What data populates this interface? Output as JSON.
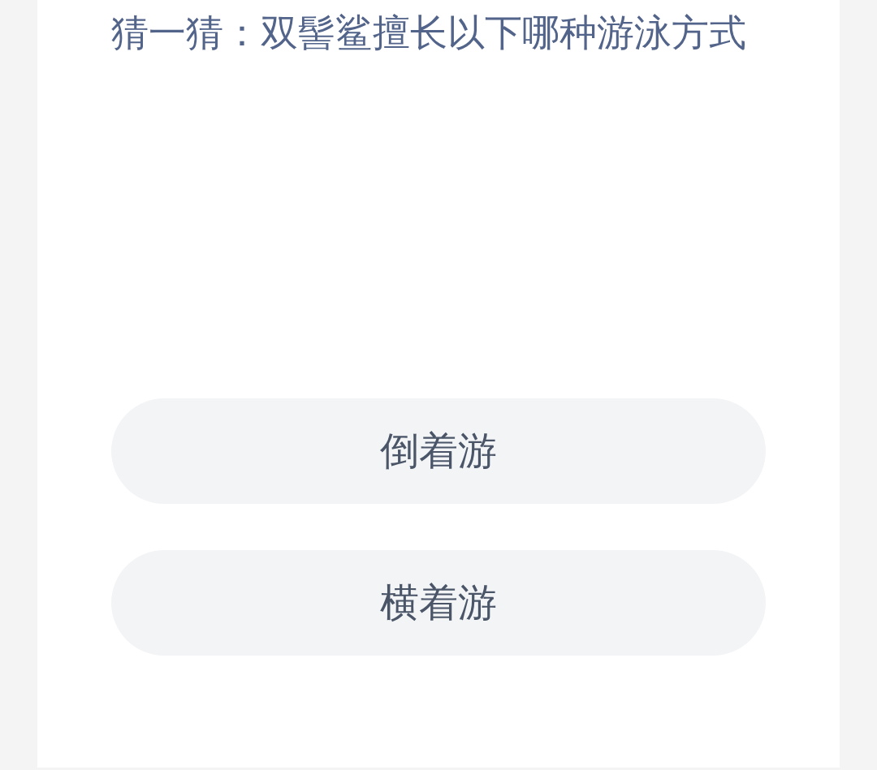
{
  "question": "猜一猜：双髻鲨擅长以下哪种游泳方式",
  "options": [
    {
      "label": "倒着游"
    },
    {
      "label": "横着游"
    }
  ]
}
